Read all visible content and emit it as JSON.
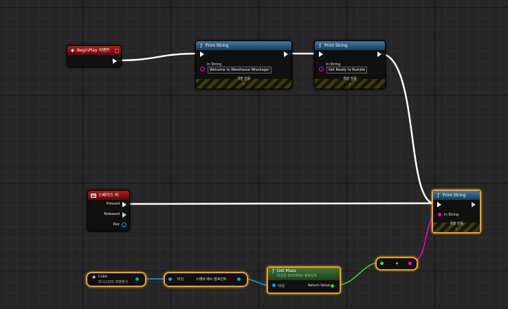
{
  "nodes": {
    "begin_play": {
      "title": "BeginPlay 이벤트"
    },
    "print1": {
      "title": "Print String",
      "in_string_label": "In String",
      "value": "Welcome to Warehouse Wreckage!",
      "dev_label": "개발 전용"
    },
    "print2": {
      "title": "Print String",
      "in_string_label": "In String",
      "value": "Get Ready to Rumble",
      "dev_label": "개발 전용"
    },
    "print3": {
      "title": "Print String",
      "in_string_label": "In String",
      "dev_label": "개발 전용"
    },
    "spacebar": {
      "title": "스페이스 바",
      "pressed": "Pressed",
      "released": "Released",
      "key": "Key"
    },
    "cube": {
      "title": "Cube",
      "subtitle": "퍼시스턴트 레벨에서"
    },
    "target_node": {
      "left": "타깃",
      "right": "스태틱 메시 컴포넌트"
    },
    "get_mass": {
      "title": "Get Mass",
      "subtitle": "타깃은 프리미티브 컴포넌트",
      "target": "타깃",
      "return": "Return Value"
    }
  },
  "icons": {
    "event": "event-icon",
    "function": "function-icon",
    "keyboard": "keyboard-icon",
    "object": "cube-icon"
  },
  "colors": {
    "exec": "#ffffff",
    "string_pin": "#ff00d4",
    "object_pin": "#00a8f0",
    "float_pin": "#3cd93c",
    "selection": "#f0a020"
  }
}
